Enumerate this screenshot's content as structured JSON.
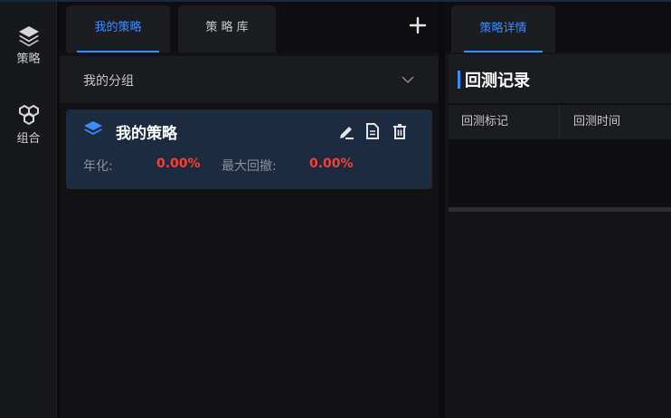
{
  "rail": {
    "items": [
      {
        "label": "策略",
        "icon": "layers-icon"
      },
      {
        "label": "组合",
        "icon": "cubes-icon"
      }
    ]
  },
  "left_tabs": {
    "items": [
      {
        "label": "我的策略",
        "active": true
      },
      {
        "label": "策 略 库",
        "active": false
      }
    ],
    "add_icon": "plus-icon"
  },
  "group": {
    "title": "我的分组",
    "expander_icon": "chevron-down-icon"
  },
  "strategy_card": {
    "title": "我的策略",
    "annual_label": "年化:",
    "annual_value": "0.00%",
    "drawdown_label": "最大回撤:",
    "drawdown_value": "0.00%",
    "actions": [
      "edit-icon",
      "document-icon",
      "delete-icon"
    ]
  },
  "right_tabs": {
    "items": [
      {
        "label": "策略详情",
        "active": true
      }
    ]
  },
  "backtest": {
    "title": "回测记录",
    "columns": [
      "回测标记",
      "回测时间"
    ]
  },
  "colors": {
    "accent": "#3b8cff",
    "negative": "#ff3b2f",
    "card_bg": "#1d2b41"
  }
}
